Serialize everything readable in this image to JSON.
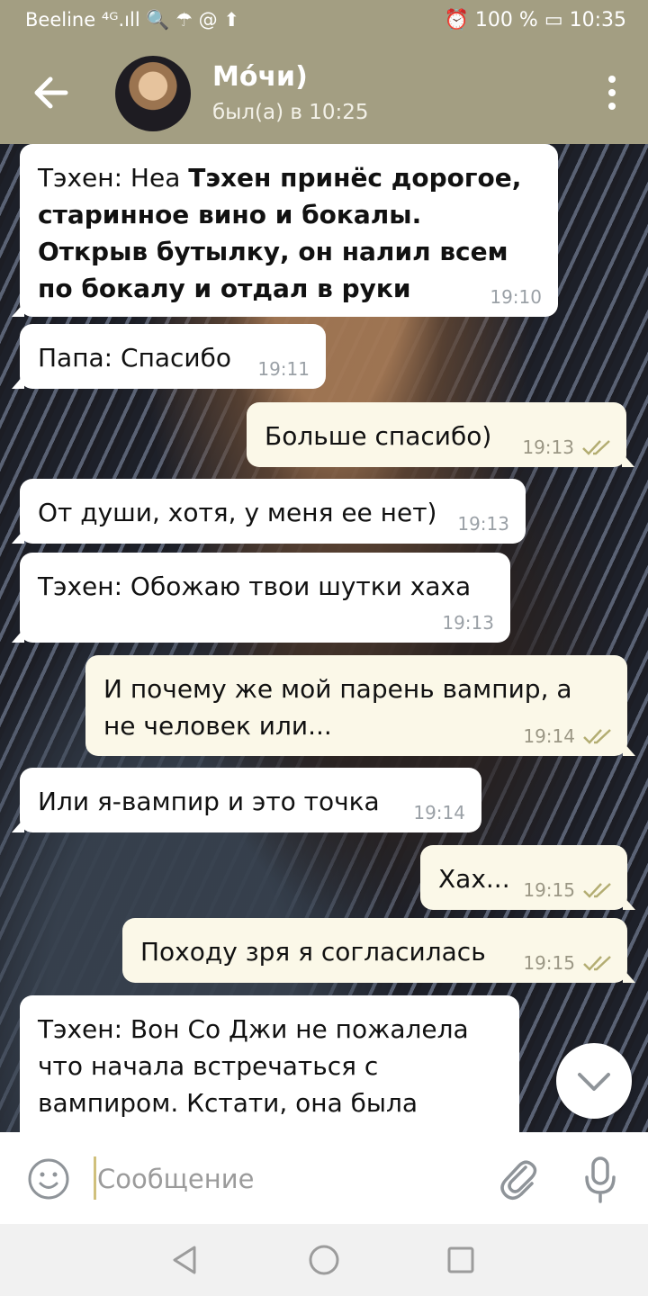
{
  "status_bar": {
    "left_text": "Beeline ⁴ᴳ.ıll  🔍 ☂ @ ⬆",
    "right_text": "⏰ 100 % ▭ 10:35"
  },
  "header": {
    "contact_name": "Мо́чи)",
    "last_seen": "был(а) в 10:25"
  },
  "messages": [
    {
      "side": "in",
      "text": "Тэхен: Неа ",
      "emphasis": "Тэхен принёс дорогое, старинное вино и бокалы. Открыв бутылку, он налил всем по бокалу и отдал в руки",
      "time": "19:10"
    },
    {
      "side": "in",
      "text": "Папа: Спасибо",
      "time": "19:11"
    },
    {
      "side": "out",
      "text": "Больше спасибо)",
      "time": "19:13"
    },
    {
      "side": "in",
      "text": "От души, хотя, у меня ее нет)",
      "time": "19:13"
    },
    {
      "side": "in",
      "text": "Тэхен: Обожаю твои шутки хаха",
      "time": "19:13"
    },
    {
      "side": "out",
      "text": "И почему же мой парень вампир, а не человек или...",
      "time": "19:14"
    },
    {
      "side": "in",
      "text": "Или я-вампир и это точка",
      "time": "19:14"
    },
    {
      "side": "out",
      "text": "Хах...",
      "time": "19:15"
    },
    {
      "side": "out",
      "text": "Походу зря я согласилась",
      "time": "19:15"
    },
    {
      "side": "in",
      "text": "Тэхен: Вон Со Джи не пожалела что начала встречаться с вампиром. Кстати, она была человеком до знакомства со",
      "time": ""
    }
  ],
  "composer": {
    "placeholder": "Сообщение"
  },
  "icons": {
    "back": "back-arrow-icon",
    "menu": "more-vert-icon",
    "emoji": "emoji-icon",
    "attach": "paperclip-icon",
    "mic": "microphone-icon",
    "scroll": "chevron-down-icon",
    "read": "double-check-icon",
    "nav_back": "triangle-back-icon",
    "nav_home": "circle-home-icon",
    "nav_recent": "square-recent-icon"
  },
  "colors": {
    "header": "#a39e82",
    "outgoing_bubble": "#fbf8e8",
    "incoming_bubble": "#ffffff",
    "read_check": "#b3ad72"
  }
}
